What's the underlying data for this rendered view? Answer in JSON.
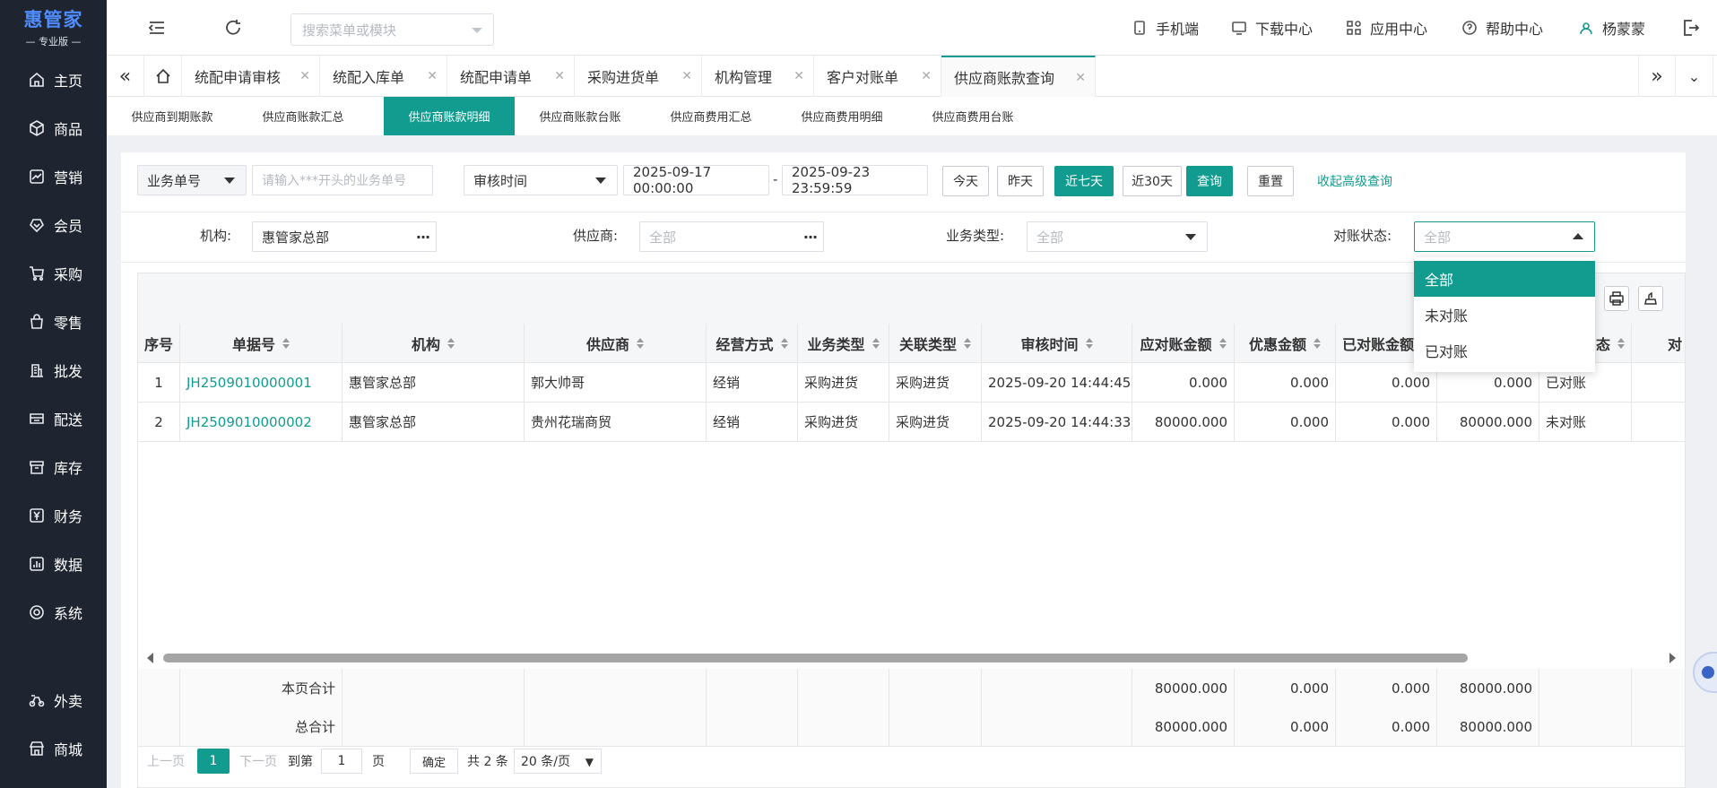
{
  "brand": {
    "name": "惠管家",
    "edition": "专业版"
  },
  "sidebar": {
    "items": [
      {
        "label": "主页",
        "icon": "home-icon"
      },
      {
        "label": "商品",
        "icon": "box-icon"
      },
      {
        "label": "营销",
        "icon": "chart-icon"
      },
      {
        "label": "会员",
        "icon": "heart-icon"
      },
      {
        "label": "采购",
        "icon": "cart-icon"
      },
      {
        "label": "零售",
        "icon": "bag-icon"
      },
      {
        "label": "批发",
        "icon": "building-icon"
      },
      {
        "label": "配送",
        "icon": "truck-icon"
      },
      {
        "label": "库存",
        "icon": "archive-icon"
      },
      {
        "label": "财务",
        "icon": "yen-icon"
      },
      {
        "label": "数据",
        "icon": "bar-chart-icon"
      },
      {
        "label": "系统",
        "icon": "gear-icon"
      },
      {
        "label": "外卖",
        "icon": "delivery-icon"
      },
      {
        "label": "商城",
        "icon": "store-icon"
      }
    ]
  },
  "topbar": {
    "search_placeholder": "搜索菜单或模块",
    "links": [
      {
        "label": "手机端",
        "icon": "phone-icon"
      },
      {
        "label": "下载中心",
        "icon": "monitor-icon"
      },
      {
        "label": "应用中心",
        "icon": "apps-icon"
      },
      {
        "label": "帮助中心",
        "icon": "help-icon"
      },
      {
        "label": "杨蒙蒙",
        "icon": "user-icon"
      }
    ]
  },
  "tabs": [
    {
      "label": "统配申请审核",
      "active": false
    },
    {
      "label": "统配入库单",
      "active": false
    },
    {
      "label": "统配申请单",
      "active": false
    },
    {
      "label": "采购进货单",
      "active": false
    },
    {
      "label": "机构管理",
      "active": false
    },
    {
      "label": "客户对账单",
      "active": false
    },
    {
      "label": "供应商账款查询",
      "active": true
    }
  ],
  "subtabs": [
    {
      "label": "供应商到期账款",
      "active": false
    },
    {
      "label": "供应商账款汇总",
      "active": false
    },
    {
      "label": "供应商账款明细",
      "active": true
    },
    {
      "label": "供应商账款台账",
      "active": false
    },
    {
      "label": "供应商费用汇总",
      "active": false
    },
    {
      "label": "供应商费用明细",
      "active": false
    },
    {
      "label": "供应商费用台账",
      "active": false
    }
  ],
  "filters": {
    "doc_type": "业务单号",
    "doc_placeholder": "请输入***开头的业务单号",
    "time_type": "审核时间",
    "date_from": "2025-09-17 00:00:00",
    "date_sep": "-",
    "date_to": "2025-09-23 23:59:59",
    "btn_today": "今天",
    "btn_yesterday": "昨天",
    "btn_7days": "近七天",
    "btn_30days": "近30天",
    "btn_query": "查询",
    "btn_reset": "重置",
    "btn_collapse": "收起高级查询",
    "org_label": "机构:",
    "org_value": "惠管家总部",
    "supplier_label": "供应商:",
    "supplier_placeholder": "全部",
    "biz_type_label": "业务类型:",
    "biz_type_placeholder": "全部",
    "recon_label": "对账状态:",
    "recon_placeholder": "全部",
    "dots": "···"
  },
  "recon_dropdown": {
    "options": [
      {
        "label": "全部",
        "selected": true
      },
      {
        "label": "未对账",
        "selected": false
      },
      {
        "label": "已对账",
        "selected": false
      }
    ]
  },
  "table": {
    "columns": [
      "序号",
      "单据号",
      "机构",
      "供应商",
      "经营方式",
      "业务类型",
      "关联类型",
      "审核时间",
      "应对账金额",
      "优惠金额",
      "已对账金额",
      "",
      "态",
      "对"
    ],
    "rows": [
      {
        "no": "1",
        "doc": "JH2509010000001",
        "org": "惠管家总部",
        "supplier": "郭大帅哥",
        "mode": "经销",
        "biz": "采购进货",
        "rel": "采购进货",
        "time": "2025-09-20 14:44:45",
        "amount": "0.000",
        "discount": "0.000",
        "reconciled": "0.000",
        "unreconciled": "0.000",
        "status": "已对账"
      },
      {
        "no": "2",
        "doc": "JH2509010000002",
        "org": "惠管家总部",
        "supplier": "贵州花瑞商贸",
        "mode": "经销",
        "biz": "采购进货",
        "rel": "采购进货",
        "time": "2025-09-20 14:44:33",
        "amount": "80000.000",
        "discount": "0.000",
        "reconciled": "0.000",
        "unreconciled": "80000.000",
        "status": "未对账"
      }
    ],
    "page_total": {
      "label": "本页合计",
      "amount": "80000.000",
      "discount": "0.000",
      "reconciled": "0.000",
      "unreconciled": "80000.000"
    },
    "grand_total": {
      "label": "总合计",
      "amount": "80000.000",
      "discount": "0.000",
      "reconciled": "0.000",
      "unreconciled": "80000.000"
    }
  },
  "pager": {
    "prev": "上一页",
    "current": "1",
    "next": "下一页",
    "goto": "到第",
    "goto_value": "1",
    "page_unit": "页",
    "confirm": "确定",
    "total": "共 2 条",
    "page_size": "20 条/页"
  },
  "colors": {
    "accent": "#129b8f",
    "sidebar_bg": "#1f2530",
    "brand_blue": "#4f8dff"
  }
}
